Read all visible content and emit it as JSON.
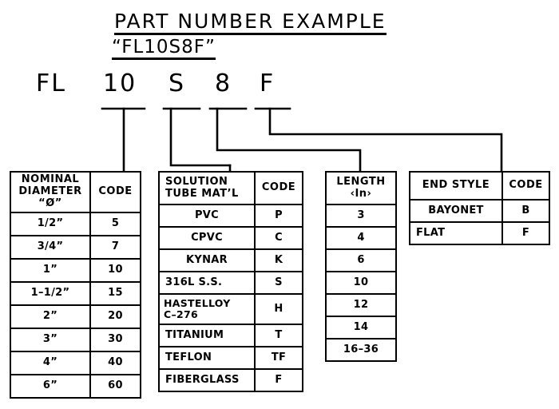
{
  "title": {
    "main": "PART NUMBER EXAMPLE",
    "sub": "“FL10S8F”"
  },
  "part_number": {
    "segments": [
      {
        "text": "FL",
        "meaning": "prefix"
      },
      {
        "text": "10",
        "meaning": "nominal-diameter"
      },
      {
        "text": "S",
        "meaning": "solution-tube-material"
      },
      {
        "text": "8",
        "meaning": "length"
      },
      {
        "text": "F",
        "meaning": "end-style"
      }
    ]
  },
  "tables": {
    "nominal_diameter": {
      "headers": [
        "NOMINAL\nDIAMETER\n“Ø”",
        "CODE"
      ],
      "rows": [
        [
          "1/2”",
          "5"
        ],
        [
          "3/4”",
          "7"
        ],
        [
          "1”",
          "10"
        ],
        [
          "1–1/2”",
          "15"
        ],
        [
          "2”",
          "20"
        ],
        [
          "3”",
          "30"
        ],
        [
          "4”",
          "40"
        ],
        [
          "6”",
          "60"
        ]
      ]
    },
    "solution_tube": {
      "headers": [
        "SOLUTION\nTUBE MAT’L",
        "CODE"
      ],
      "rows": [
        [
          "PVC",
          "P"
        ],
        [
          "CPVC",
          "C"
        ],
        [
          "KYNAR",
          "K"
        ],
        [
          "316L S.S.",
          "S"
        ],
        [
          "HASTELLOY\nC–276",
          "H"
        ],
        [
          "TITANIUM",
          "T"
        ],
        [
          "TEFLON",
          "TF"
        ],
        [
          "FIBERGLASS",
          "F"
        ]
      ]
    },
    "length": {
      "headers": [
        "LENGTH\n‹In›"
      ],
      "rows": [
        [
          "3"
        ],
        [
          "4"
        ],
        [
          "6"
        ],
        [
          "10"
        ],
        [
          "12"
        ],
        [
          "14"
        ],
        [
          "16–36"
        ]
      ]
    },
    "end_style": {
      "headers": [
        "END STYLE",
        "CODE"
      ],
      "rows": [
        [
          "BAYONET",
          "B"
        ],
        [
          "FLAT",
          "F"
        ]
      ]
    }
  },
  "colors": {
    "ink": "#000000",
    "paper": "#ffffff"
  }
}
